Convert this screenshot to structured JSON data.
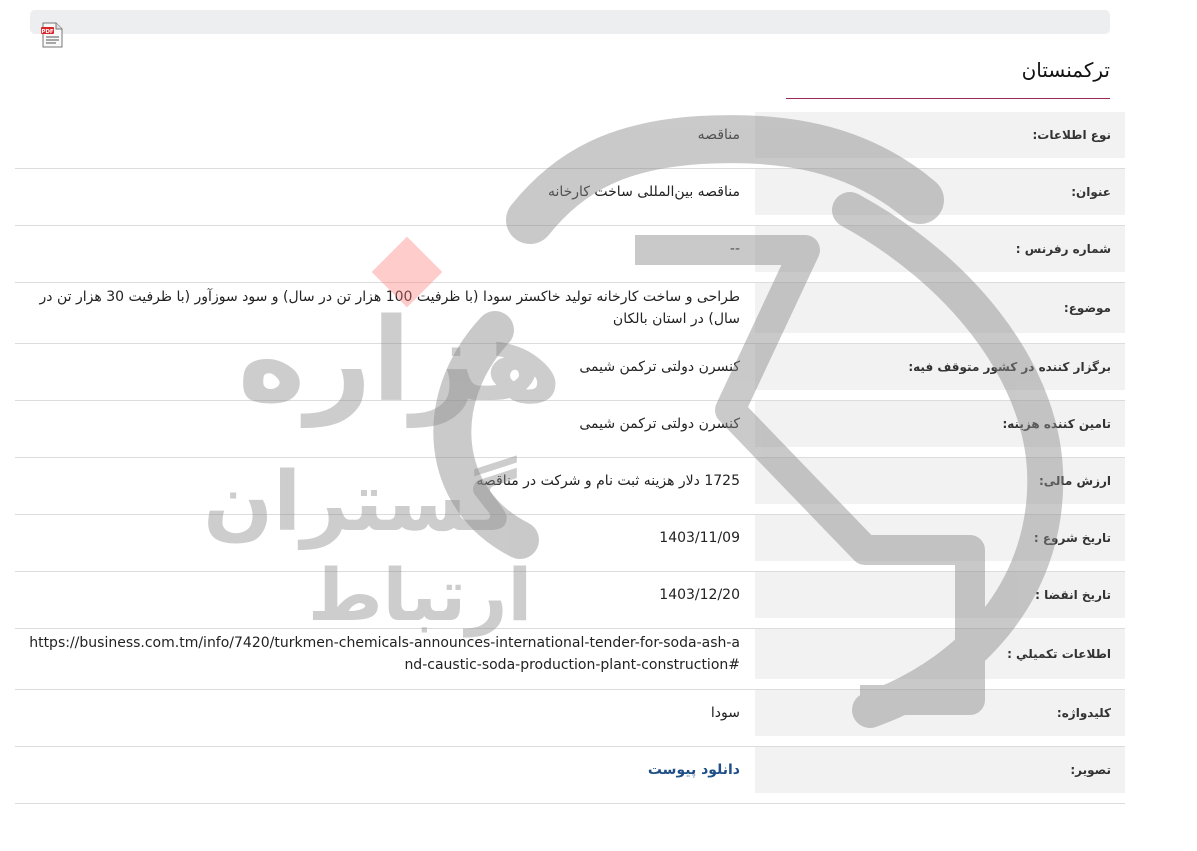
{
  "page": {
    "title": "ترکمنستان",
    "pdf_icon": "pdf-file-icon"
  },
  "rows": [
    {
      "label": "نوع اطلاعات:",
      "value": "مناقصه"
    },
    {
      "label": "عنوان:",
      "value": "مناقصه بین‌المللی ساخت کارخانه"
    },
    {
      "label": "شماره رفرنس :",
      "value": "--"
    },
    {
      "label": "موضوع:",
      "value": "طراحی و ساخت کارخانه تولید خاکستر سودا (با ظرفیت 100 هزار تن در سال) و سود سوزآور (با ظرفیت 30 هزار تن در سال) در استان بالکان"
    },
    {
      "label": "برگزار کننده در کشور متوقف فیه:",
      "value": "کنسرن دولتی ترکمن شیمی"
    },
    {
      "label": "تامین کننده هزینه:",
      "value": "کنسرن دولتی ترکمن شیمی"
    },
    {
      "label": "ارزش مالی:",
      "value": "1725 دلار هزینه ثبت نام و شرکت در مناقصه"
    },
    {
      "label": "تاریخ شروع :",
      "value": "1403/11/09"
    },
    {
      "label": "تاریخ انقضا :",
      "value": "1403/12/20"
    },
    {
      "label": "اطلاعات تکمیلي :",
      "value": "https://business.com.tm/info/7420/turkmen-chemicals-announces-international-tender-for-soda-ash-and-caustic-soda-production-plant-construction#"
    },
    {
      "label": "کلیدواژه:",
      "value": "سودا"
    },
    {
      "label": "تصویر:",
      "value": "دانلود پیوست"
    }
  ],
  "watermark": {
    "logo": "hezare-logo",
    "text_main": "هزاره",
    "text_sub1": "گستران",
    "text_sub2": "ارتباط"
  },
  "colors": {
    "accent_line": "#9a2a55",
    "link": "#1f4f86",
    "label_bg": "#f2f2f2"
  }
}
